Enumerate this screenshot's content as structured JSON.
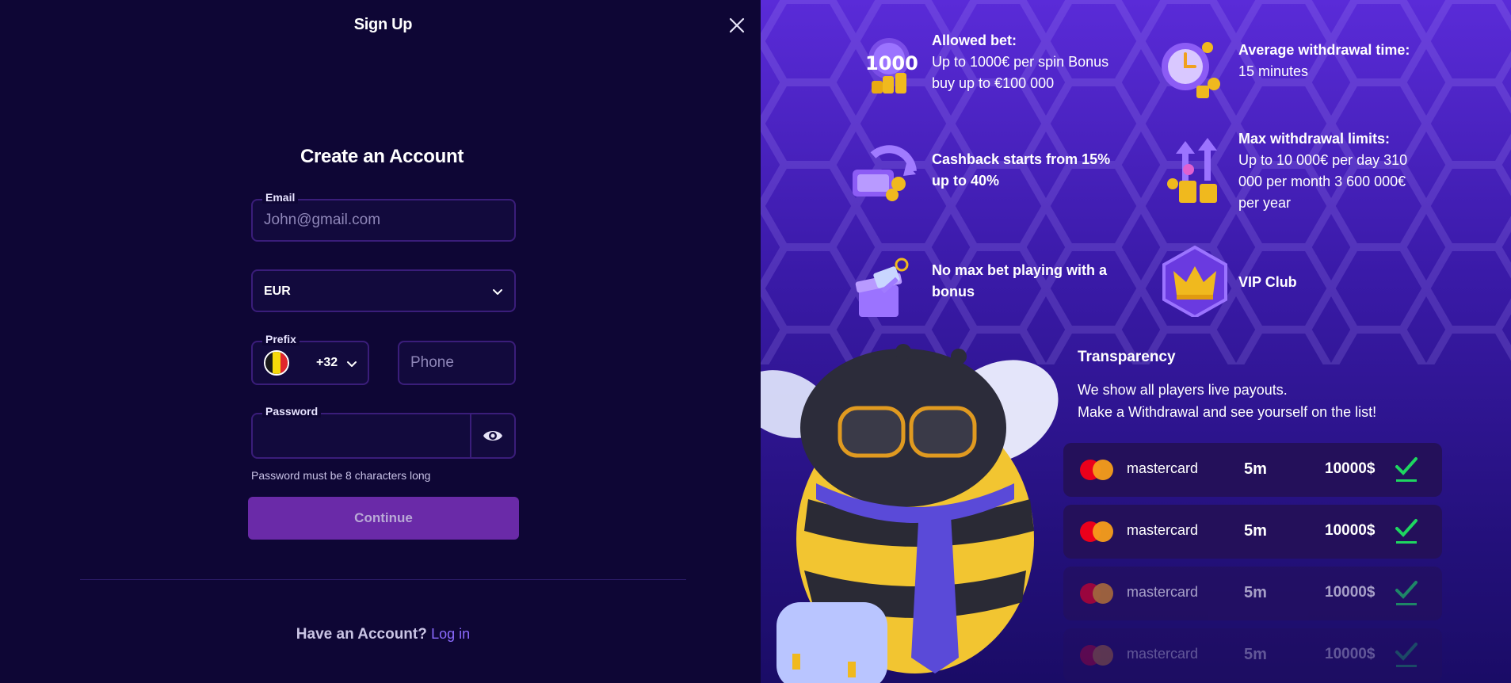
{
  "header": {
    "title": "Sign Up"
  },
  "form": {
    "title": "Create an Account",
    "email_label": "Email",
    "email_placeholder": "John@gmail.com",
    "currency": "EUR",
    "prefix_label": "Prefix",
    "prefix_value": "+32",
    "phone_placeholder": "Phone",
    "password_label": "Password",
    "password_hint": "Password must be 8 characters long",
    "continue_label": "Continue",
    "have_account": "Have an Account?",
    "login_link": "Log in"
  },
  "features": [
    {
      "title": "Allowed bet:",
      "body": "Up to 1000€ per spin Bonus buy up to €100 000",
      "icon": "bet-1000-icon"
    },
    {
      "title": "Average withdrawal time:",
      "body": "15 minutes",
      "icon": "clock-coins-icon"
    },
    {
      "title": "Cashback starts from 15% up to 40%",
      "body": "",
      "icon": "cashback-icon"
    },
    {
      "title": "Max withdrawal limits:",
      "body": "Up to 10 000€ per day 310 000 per month 3 600 000€ per year",
      "icon": "withdrawal-limits-icon"
    },
    {
      "title": "No max bet playing with a bonus",
      "body": "",
      "icon": "gift-bonus-icon"
    },
    {
      "title": "VIP Club",
      "body": "",
      "icon": "crown-icon"
    }
  ],
  "bet_icon_text": "1000",
  "transparency": {
    "title": "Transparency",
    "line1": "We show all players live payouts.",
    "line2": "Make a Withdrawal and see yourself on the list!"
  },
  "payouts": [
    {
      "method": "mastercard",
      "time": "5m",
      "amount": "10000$",
      "opacity": 1
    },
    {
      "method": "mastercard",
      "time": "5m",
      "amount": "10000$",
      "opacity": 1
    },
    {
      "method": "mastercard",
      "time": "5m",
      "amount": "10000$",
      "opacity": 0.6
    },
    {
      "method": "mastercard",
      "time": "5m",
      "amount": "10000$",
      "opacity": 0.3
    }
  ],
  "colors": {
    "left_bg": "#0e0635",
    "accent_button": "#6a2aa8",
    "link": "#8c6bff",
    "check_green": "#1ed760"
  }
}
